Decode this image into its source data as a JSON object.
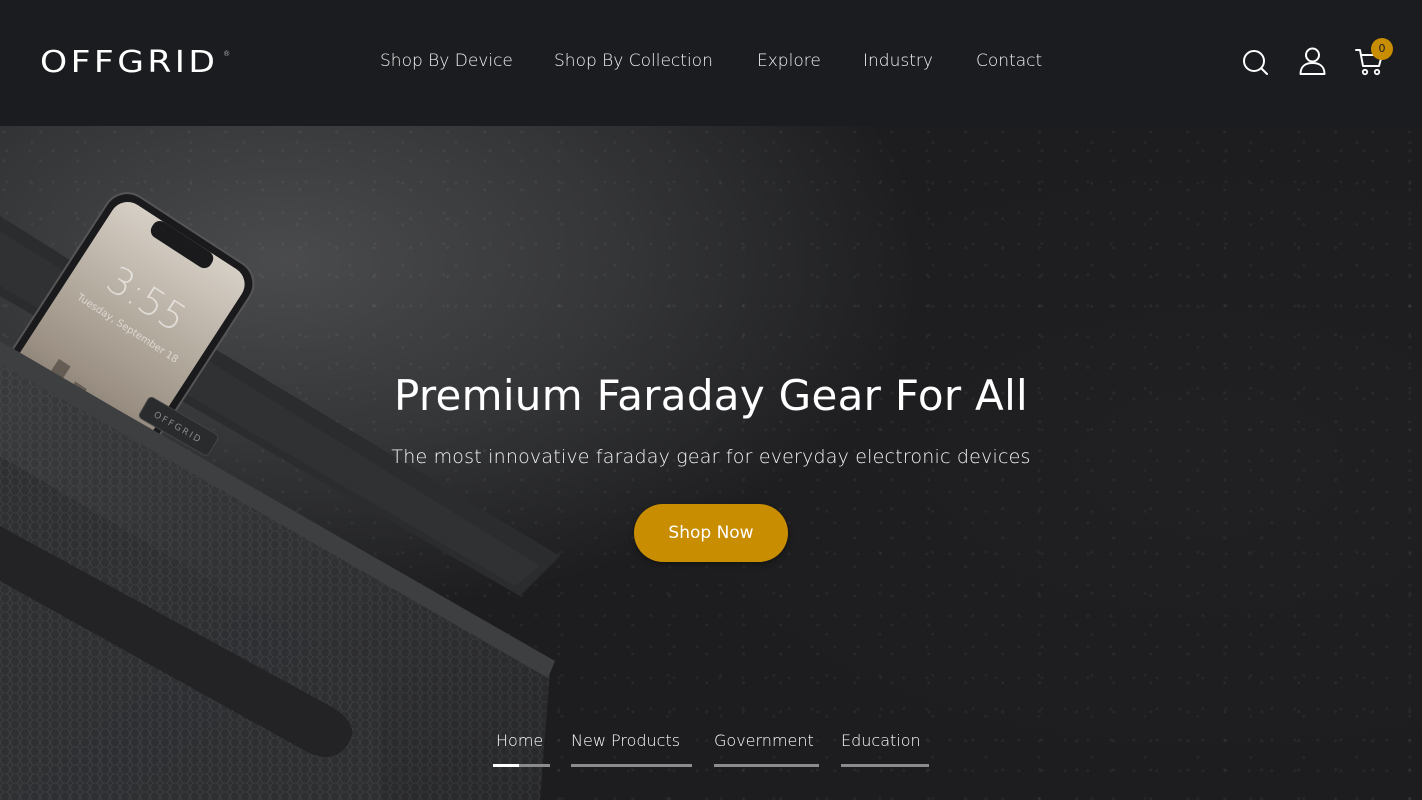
{
  "header": {
    "logo": "OFFGRID",
    "logo_registered": "®",
    "nav": [
      {
        "label": "Shop By Device"
      },
      {
        "label": "Shop By Collection"
      },
      {
        "label": "Explore"
      },
      {
        "label": "Industry"
      },
      {
        "label": "Contact"
      }
    ],
    "icons": {
      "search": "search-icon",
      "account": "user-icon",
      "cart": "cart-icon"
    },
    "cart_count": "0"
  },
  "hero": {
    "title": "Premium Faraday Gear For All",
    "subtitle": "The most innovative faraday gear for everyday electronic devices",
    "cta_label": "Shop Now",
    "phone_time": "3:55",
    "phone_date": "Tuesday, September 18",
    "bag_tag": "OFFGRID",
    "slides": [
      {
        "label": "Home",
        "progress": 0.45
      },
      {
        "label": "New Products",
        "progress": 0
      },
      {
        "label": "Government",
        "progress": 0
      },
      {
        "label": "Education",
        "progress": 0
      }
    ]
  },
  "colors": {
    "header_bg": "#1b1c20",
    "accent": "#c88d00",
    "text": "#ffffff"
  }
}
